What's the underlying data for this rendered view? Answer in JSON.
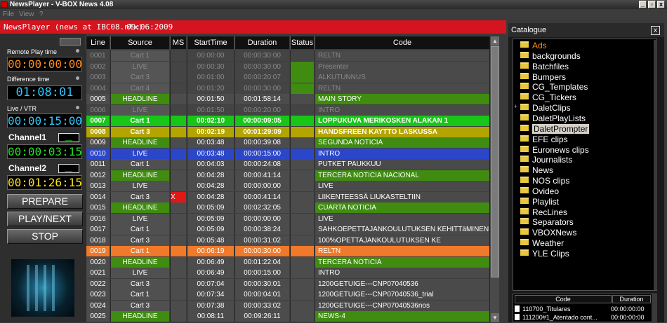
{
  "app": {
    "title": "NewsPlayer  -  V-BOX News 4.08",
    "window_buttons": [
      "_",
      "▫",
      "x"
    ]
  },
  "menu": [
    "File",
    "View",
    "?"
  ],
  "statusbar": {
    "info": "NewsPlayer  (news at IBC08.nlx)",
    "time": "09:06:2009"
  },
  "left": {
    "remote_play_time_label": "Remote Play time",
    "remote_play_time": "00:00:00:00",
    "difference_time_label": "Difference time",
    "difference_time": "01:08:01",
    "live_vtr_label": "Live / VTR",
    "live_vtr_time": "00:00:15:00",
    "channel1_label": "Channel1",
    "channel1_btn": "__",
    "channel1_time": "00:00:03:15",
    "channel2_label": "Channel2",
    "channel2_btn": "__",
    "channel2_time": "00:01:26:15",
    "prepare": "PREPARE",
    "playnext": "PLAY/NEXT",
    "stop": "STOP"
  },
  "playlist": {
    "columns": [
      "Line",
      "Source",
      "MS",
      "StartTime",
      "Duration",
      "Status",
      "Code"
    ],
    "rows": [
      {
        "line": "0001",
        "source": "Cart 1",
        "ms": "",
        "start": "00:00:00",
        "dur": "00:00:30:00",
        "status": "",
        "code": "RELTN",
        "style": "dim"
      },
      {
        "line": "0002",
        "source": "LIVE",
        "ms": "",
        "start": "00:00:30",
        "dur": "00:00:30:00",
        "status": "green",
        "code": "Presenter",
        "style": "dim"
      },
      {
        "line": "0003",
        "source": "Cart 3",
        "ms": "",
        "start": "00:01:00",
        "dur": "00:00:20:07",
        "status": "green",
        "code": "ALKUTUNNUS",
        "style": "dim"
      },
      {
        "line": "0004",
        "source": "Cart 4",
        "ms": "",
        "start": "00:01:20",
        "dur": "00:00:30:00",
        "status": "green",
        "code": "RELTN",
        "style": "dim"
      },
      {
        "line": "0005",
        "source": "HEADLINE",
        "ms": "",
        "start": "00:01:50",
        "dur": "00:01:58:14",
        "status": "",
        "code": "MAIN STORY",
        "style": "headline"
      },
      {
        "line": "0006",
        "source": "LIVE",
        "ms": "",
        "start": "00:01:50",
        "dur": "00:00:20:00",
        "status": "",
        "code": "INTRO",
        "style": "dim"
      },
      {
        "line": "0007",
        "source": "Cart 1",
        "ms": "",
        "start": "00:02:10",
        "dur": "00:00:09:05",
        "status": "",
        "code": "LOPPUKUVA MERIKOSKEN ALAKAN 1",
        "style": "playing"
      },
      {
        "line": "0008",
        "source": "Cart 3",
        "ms": "",
        "start": "00:02:19",
        "dur": "00:01:29:09",
        "status": "",
        "code": "HANDSFREEN KAYTTO LASKUSSA",
        "style": "cued"
      },
      {
        "line": "0009",
        "source": "HEADLINE",
        "ms": "",
        "start": "00:03:48",
        "dur": "00:00:39:08",
        "status": "",
        "code": "SEGUNDA NOTICIA",
        "style": "headline"
      },
      {
        "line": "0010",
        "source": "LIVE",
        "ms": "",
        "start": "00:03:48",
        "dur": "00:00:15:00",
        "status": "",
        "code": "INTRO",
        "style": "blue"
      },
      {
        "line": "0011",
        "source": "Cart 1",
        "ms": "",
        "start": "00:04:03",
        "dur": "00:00:24:08",
        "status": "",
        "code": "PUTKET PAUKKUU",
        "style": "normal"
      },
      {
        "line": "0012",
        "source": "HEADLINE",
        "ms": "",
        "start": "00:04:28",
        "dur": "00:00:41:14",
        "status": "",
        "code": "TERCERA NOTICIA NACIONAL",
        "style": "headline"
      },
      {
        "line": "0013",
        "source": "LIVE",
        "ms": "",
        "start": "00:04:28",
        "dur": "00:00:00:00",
        "status": "",
        "code": "LIVE",
        "style": "normal"
      },
      {
        "line": "0014",
        "source": "Cart 3",
        "ms": "X",
        "start": "00:04:28",
        "dur": "00:00:41:14",
        "status": "",
        "code": "LIIKENTEESSÄ LIUKASTELTIIN",
        "style": "normal"
      },
      {
        "line": "0015",
        "source": "HEADLINE",
        "ms": "",
        "start": "00:05:09",
        "dur": "00:02:32:05",
        "status": "",
        "code": "CUARTA NOTICIA",
        "style": "headline"
      },
      {
        "line": "0016",
        "source": "LIVE",
        "ms": "",
        "start": "00:05:09",
        "dur": "00:00:00:00",
        "status": "",
        "code": "LIVE",
        "style": "normal"
      },
      {
        "line": "0017",
        "source": "Cart 1",
        "ms": "",
        "start": "00:05:09",
        "dur": "00:00:38:24",
        "status": "",
        "code": "SAHKOEPETTAJANKOULUTUKSEN KEHITTäMINEN",
        "style": "normal"
      },
      {
        "line": "0018",
        "source": "Cart 3",
        "ms": "",
        "start": "00:05:48",
        "dur": "00:00:31:02",
        "status": "",
        "code": "100%OPETTAJANKOULUTUKSEN KE",
        "style": "normal"
      },
      {
        "line": "0019",
        "source": "Cart 1",
        "ms": "",
        "start": "00:06:19",
        "dur": "00:00:30:00",
        "status": "",
        "code": "RELTN",
        "style": "orange"
      },
      {
        "line": "0020",
        "source": "HEADLINE",
        "ms": "",
        "start": "00:06:49",
        "dur": "00:01:22:04",
        "status": "",
        "code": "TERCERA NOTICIA",
        "style": "headline"
      },
      {
        "line": "0021",
        "source": "LIVE",
        "ms": "",
        "start": "00:06:49",
        "dur": "00:00:15:00",
        "status": "",
        "code": "INTRO",
        "style": "normal"
      },
      {
        "line": "0022",
        "source": "Cart 3",
        "ms": "",
        "start": "00:07:04",
        "dur": "00:00:30:01",
        "status": "",
        "code": "1200GETUIGE---CNP07040536",
        "style": "normal"
      },
      {
        "line": "0023",
        "source": "Cart 1",
        "ms": "",
        "start": "00:07:34",
        "dur": "00:00:04:01",
        "status": "",
        "code": "1200GETUIGE---CNP07040536_trial",
        "style": "normal"
      },
      {
        "line": "0024",
        "source": "Cart 3",
        "ms": "",
        "start": "00:07:38",
        "dur": "00:00:33:02",
        "status": "",
        "code": "1200GETUIGE---CNP07040536nos",
        "style": "normal"
      },
      {
        "line": "0025",
        "source": "HEADLINE",
        "ms": "",
        "start": "00:08:11",
        "dur": "00:09:26:11",
        "status": "",
        "code": "NEWS-4",
        "style": "headline"
      }
    ]
  },
  "catalogue": {
    "title": "Catalogue",
    "close": "x",
    "items": [
      "Ads",
      "backgrounds",
      "Batchfiles",
      "Bumpers",
      "CG_Templates",
      "CG_Tickers",
      "DaletClips",
      "DaletPlayLists",
      "DaletPrompter",
      "EFE clips",
      "Euronews clips",
      "Journalists",
      "News",
      "NOS clips",
      "Ovideo",
      "Playlist",
      "RecLines",
      "Separators",
      "VBOXNews",
      "Weather",
      "YLE Clips"
    ],
    "expanded_marker": "+",
    "list_columns": [
      "Code",
      "Duration"
    ],
    "list_rows": [
      {
        "code": "110700_Titulares",
        "dur": "00:00:00:00"
      },
      {
        "code": "111200#1_Atentado cont...",
        "dur": "00:00:00:00"
      }
    ]
  },
  "colors": {
    "accent_red": "#d4141e",
    "headline_green": "#3f8c10",
    "playing_green": "#17c617",
    "cued_yellow": "#b4a400",
    "selected_blue": "#2c46c8",
    "orange": "#f07a2a",
    "lcd_orange": "#ff8c1a",
    "lcd_cyan": "#33c7ff",
    "lcd_green": "#28e028",
    "lcd_yellow": "#ffe020"
  }
}
